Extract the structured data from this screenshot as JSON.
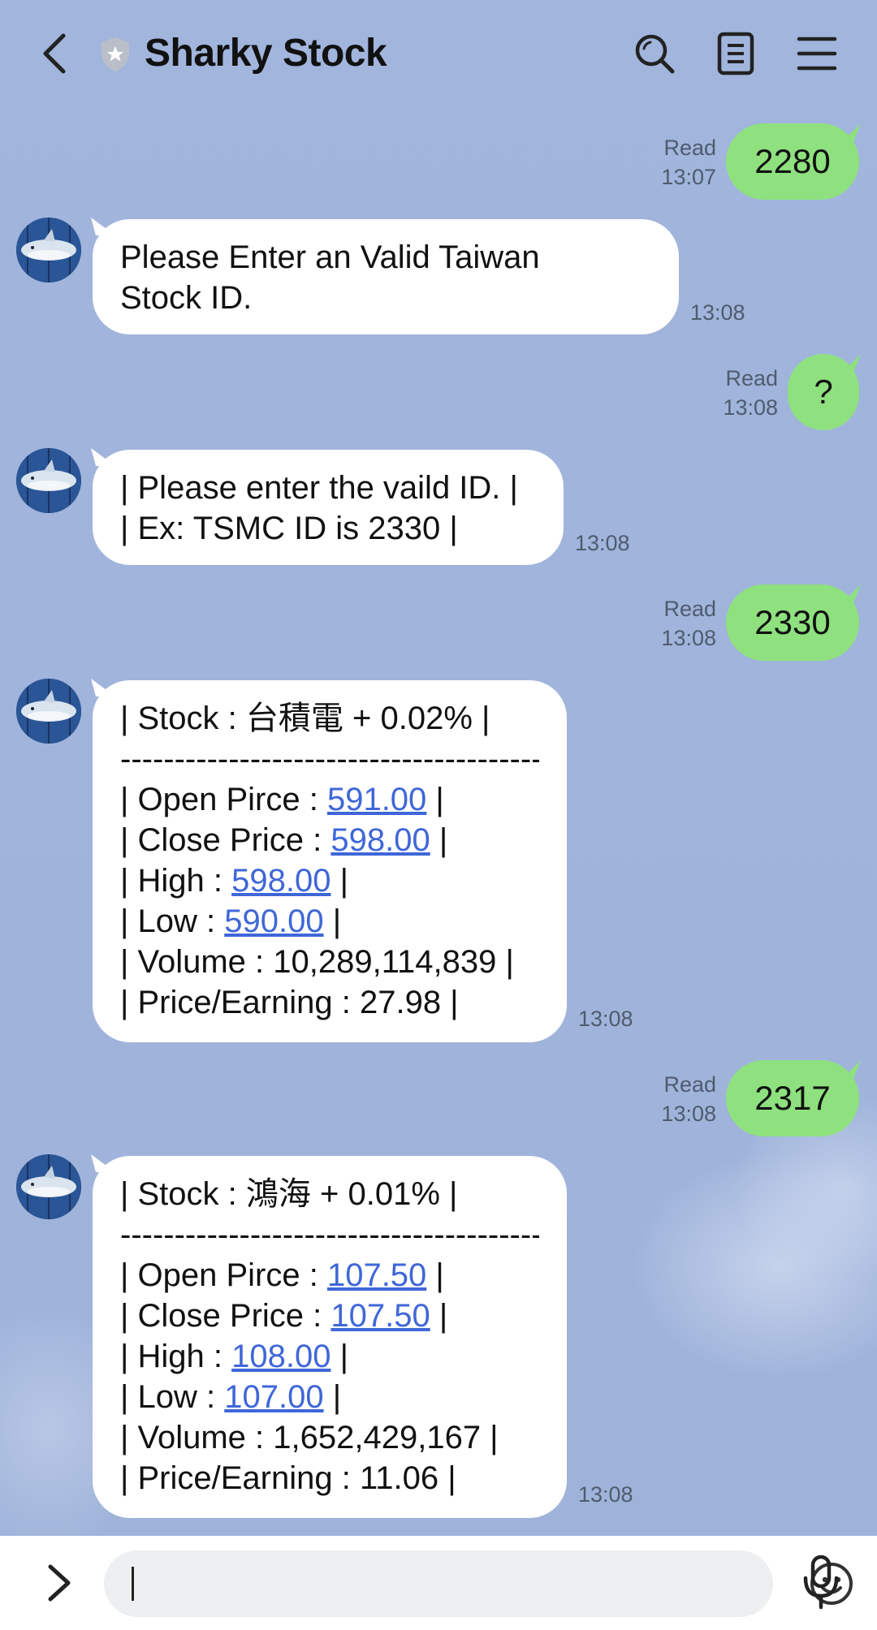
{
  "header": {
    "title": "Sharky Stock",
    "icons": [
      "chevron-left-icon",
      "shield-icon",
      "search-icon",
      "notes-icon",
      "menu-icon"
    ]
  },
  "messages": [
    {
      "type": "sent",
      "text": "2280",
      "status": "Read",
      "time": "13:07"
    },
    {
      "type": "received",
      "lines": [
        "Please Enter an Valid Taiwan",
        "Stock ID."
      ],
      "time": "13:08"
    },
    {
      "type": "sent",
      "text": "?",
      "status": "Read",
      "time": "13:08"
    },
    {
      "type": "received",
      "lines": [
        "| Please enter the vaild ID. |",
        "| Ex: TSMC ID is 2330 |"
      ],
      "time": "13:08"
    },
    {
      "type": "sent",
      "text": "2330",
      "status": "Read",
      "time": "13:08"
    },
    {
      "type": "received_stock",
      "header": "| Stock : 台積電 + 0.02% |",
      "divider": "------------------------------------------",
      "open_label": "| Open Pirce : ",
      "open": "591.00",
      "close_label": "| Close Price : ",
      "close": "598.00",
      "high_label": "| High : ",
      "high": "598.00",
      "low_label": "| Low : ",
      "low": "590.00",
      "pipe": " |",
      "volume_line": "| Volume : 10,289,114,839 |",
      "pe_line": "| Price/Earning : 27.98 |",
      "time": "13:08"
    },
    {
      "type": "sent",
      "text": "2317",
      "status": "Read",
      "time": "13:08"
    },
    {
      "type": "received_stock",
      "header": "| Stock : 鴻海 + 0.01% |",
      "divider": "------------------------------------------",
      "open_label": "| Open Pirce : ",
      "open": "107.50",
      "close_label": "| Close Price : ",
      "close": "107.50",
      "high_label": "| High : ",
      "high": "108.00",
      "low_label": "| Low : ",
      "low": "107.00",
      "pipe": " |",
      "volume_line": "| Volume : 1,652,429,167 |",
      "pe_line": "| Price/Earning : 11.06 |",
      "time": "13:08"
    }
  ],
  "input": {
    "placeholder": ""
  },
  "bottom_icons": [
    "chevron-right-icon",
    "emoji-icon",
    "microphone-icon"
  ],
  "colors": {
    "background": "#9fb3da",
    "sent_bubble": "#8ee17e",
    "received_bubble": "#ffffff",
    "link": "#3f67d8"
  }
}
